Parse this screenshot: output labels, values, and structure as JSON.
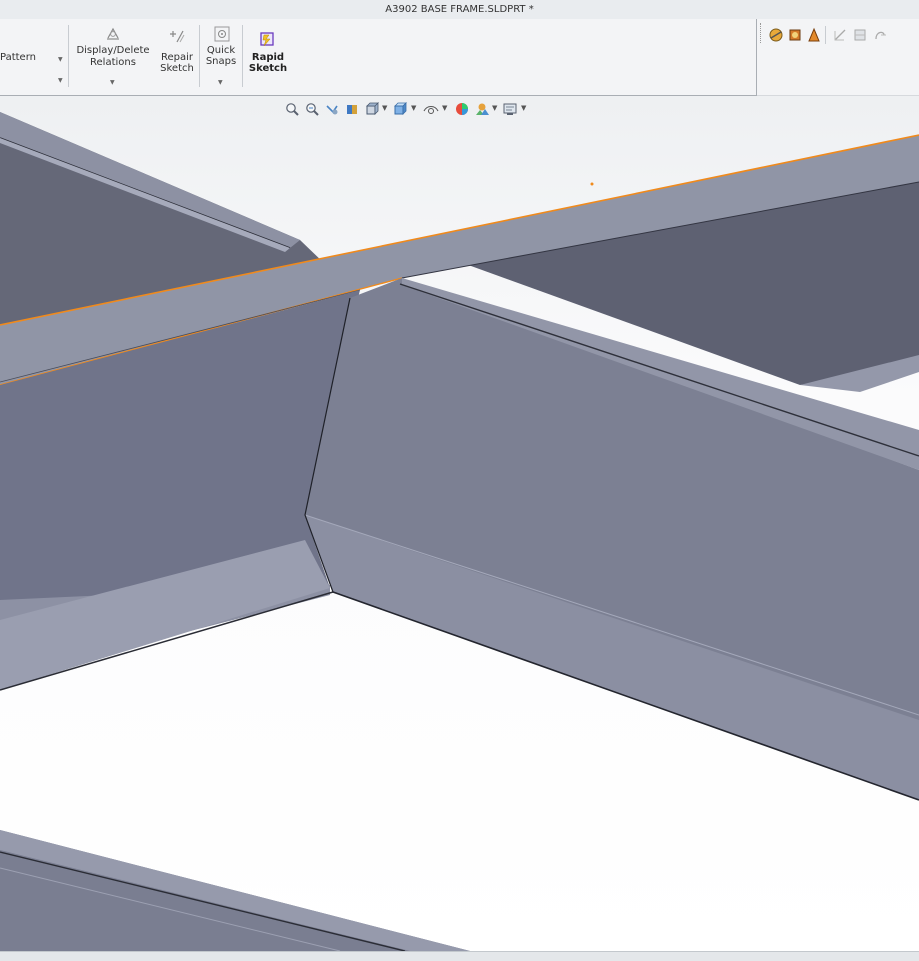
{
  "window": {
    "title": "A3902 BASE FRAME.SLDPRT *"
  },
  "ribbon": {
    "pattern_label": "Pattern",
    "display_delete_label": "Display/Delete",
    "relations_label": "Relations",
    "repair_label": "Repair",
    "sketch_label": "Sketch",
    "quick_label": "Quick",
    "snaps_label": "Snaps",
    "rapid_label": "Rapid",
    "rapid_sketch_label": "Sketch"
  },
  "icons": {
    "hud": [
      "zoom-to-fit-icon",
      "zoom-to-area-icon",
      "previous-view-icon",
      "section-view-icon",
      "view-orientation-icon",
      "display-style-icon",
      "hide-show-items-icon",
      "edit-appearance-icon",
      "apply-scene-icon",
      "view-settings-icon"
    ],
    "ribbon_right": [
      "appearance-icon",
      "display-manager-icon",
      "scene-icon",
      "sketch-tool-icon",
      "sketch-plane-icon",
      "curve-icon"
    ]
  },
  "colors": {
    "steel_top": "#969aab",
    "steel_dark": "#6f7385",
    "steel_mid": "#7f8396",
    "edge_highlight": "#f08a1c",
    "ribbon_bg": "#f3f4f6",
    "accent_rapid": "#6a3bc0"
  }
}
